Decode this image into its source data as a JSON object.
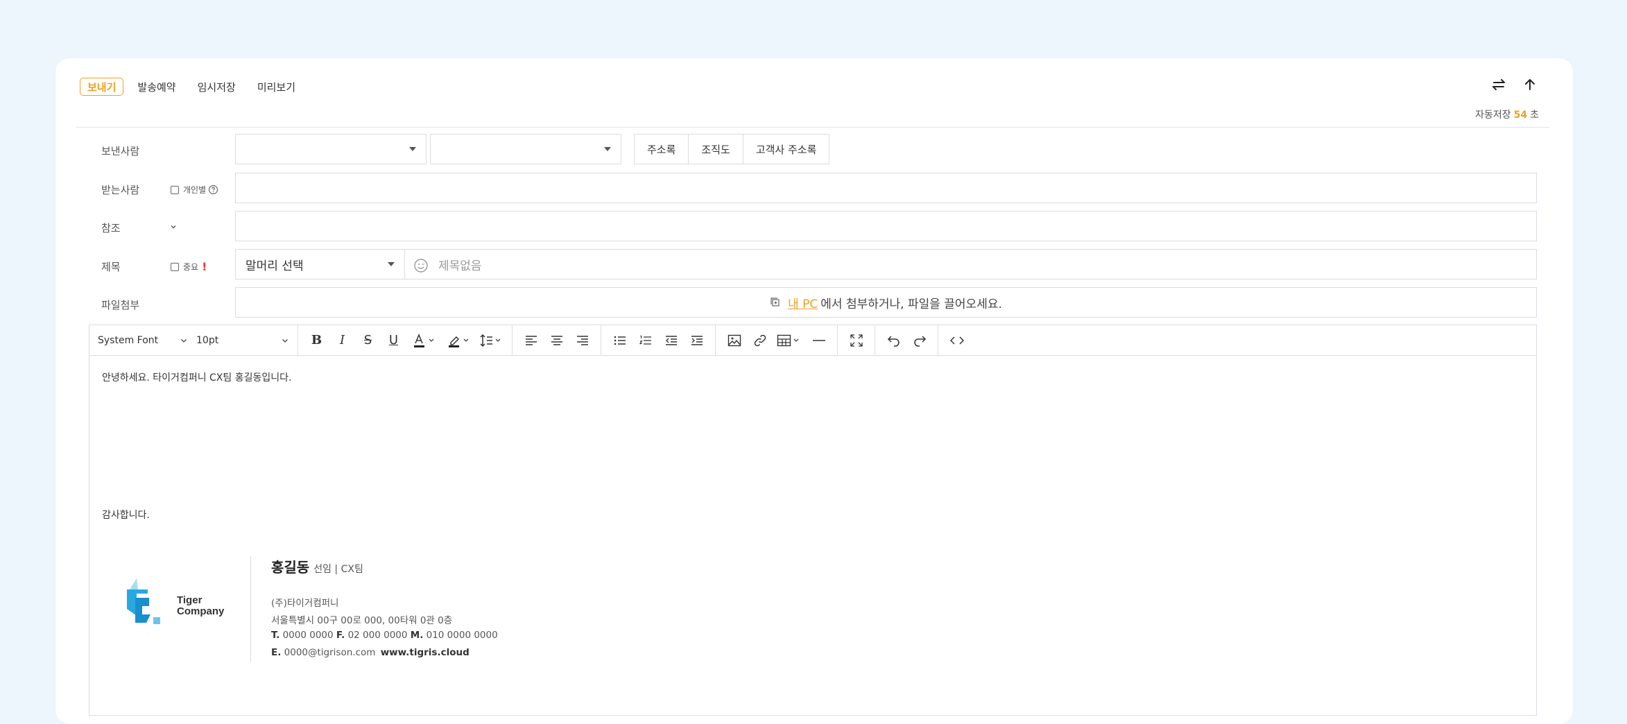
{
  "toolbar_top": {
    "send_label": "보내기",
    "schedule_label": "발송예약",
    "draft_label": "임시저장",
    "preview_label": "미리보기",
    "autosave_label": "자동저장",
    "autosave_seconds": "54",
    "autosave_unit": "초",
    "accent_color": "#f0a020"
  },
  "form": {
    "sender_label": "보낸사람",
    "address_book_label": "주소록",
    "org_chart_label": "조직도",
    "customer_address_label": "고객사 주소록",
    "to_label": "받는사람",
    "individual_label": "개인별",
    "cc_label": "참조",
    "subject_label": "제목",
    "important_label": "중요",
    "important_mark": "!",
    "prefix_select_value": "말머리 선택",
    "subject_placeholder": "제목없음",
    "attach_label": "파일첨부",
    "attach_link": "내 PC",
    "attach_text": "에서 첨부하거나, 파일을 끌어오세요."
  },
  "editor_toolbar": {
    "font_family": "System Font",
    "font_size": "10pt"
  },
  "body": {
    "greeting": "안녕하세요. 타이거컴퍼니 CX팀 홍길동입니다.",
    "closing": "감사합니다."
  },
  "signature": {
    "logo_text_line1": "Tiger",
    "logo_text_line2": "Company",
    "name": "홍길동",
    "title": "선임 | CX팀",
    "company": "(주)타이거컴퍼니",
    "address": "서울특별시 00구 00로 000, 00타워 0관 0층",
    "tel_label": "T.",
    "tel": "0000 0000",
    "fax_label": "F.",
    "fax": "02 000 0000",
    "mobile_label": "M.",
    "mobile": "010 0000 0000",
    "email_label": "E.",
    "email": "0000@tigrison.com",
    "website": "www.tigris.cloud"
  }
}
